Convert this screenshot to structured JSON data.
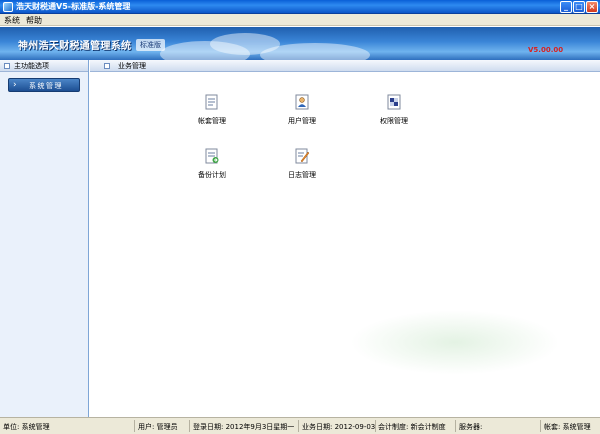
{
  "window": {
    "title": "浩天财税通V5-标准版-系统管理",
    "buttons": [
      "_",
      "□",
      "×"
    ]
  },
  "menu": [
    "系统",
    "帮助"
  ],
  "banner": {
    "brand": "神州浩天财税通管理系统",
    "edition": "标准版",
    "version": "V5.00.00"
  },
  "sidebar": {
    "header": "主功能选项",
    "nav_item": "系统管理"
  },
  "main": {
    "header": "业务管理",
    "modules": [
      {
        "label": "帐套管理",
        "icon": "account-book-icon"
      },
      {
        "label": "用户管理",
        "icon": "user-icon"
      },
      {
        "label": "权限管理",
        "icon": "permission-icon"
      },
      {
        "label": "备份计划",
        "icon": "backup-icon"
      },
      {
        "label": "日志管理",
        "icon": "log-icon"
      }
    ]
  },
  "status": {
    "unit": "单位: 系统管理",
    "user": "用户: 管理员",
    "login_date": "登录日期: 2012年9月3日星期一",
    "business_date": "业务日期: 2012-09-03",
    "accounting_system": "会计制度: 新会计制度",
    "server": "服务器:",
    "account_set": "帐套: 系统管理"
  }
}
